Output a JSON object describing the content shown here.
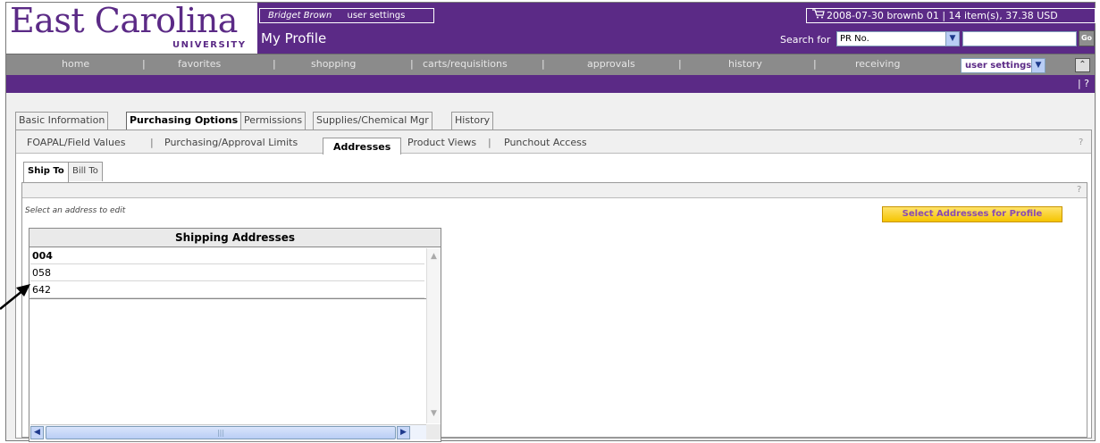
{
  "header": {
    "logo_main": "East Carolina",
    "logo_sub": "UNIVERSITY",
    "user_name": "Bridget Brown",
    "user_settings_link": "user settings",
    "page_title": "My Profile",
    "cart_summary": "2008-07-30 brownb 01 | 14 item(s), 37.38 USD",
    "search_label": "Search for",
    "search_type": "PR No.",
    "search_value": "",
    "go_label": "Go"
  },
  "nav": {
    "items": [
      "home",
      "favorites",
      "shopping",
      "carts/requisitions",
      "approvals",
      "history",
      "receiving"
    ],
    "settings_select": "user settings"
  },
  "tabs": {
    "items": [
      "Basic Information",
      "Purchasing Options",
      "Permissions",
      "Supplies/Chemical Mgr",
      "History"
    ],
    "active": "Purchasing Options"
  },
  "subnav": {
    "items": [
      "FOAPAL/Field Values",
      "Purchasing/Approval Limits",
      "Addresses",
      "Product Views",
      "Punchout Access"
    ],
    "active": "Addresses"
  },
  "address_tabs": {
    "items": [
      "Ship To",
      "Bill To"
    ],
    "active": "Ship To"
  },
  "panel": {
    "hint": "Select an address to edit",
    "select_button": "Select Addresses for Profile",
    "help": "?"
  },
  "grid": {
    "title": "Shipping Addresses",
    "rows": [
      "004",
      "058",
      "642"
    ]
  },
  "colors": {
    "brand_purple": "#5b2a86",
    "nav_gray": "#8b8b8b",
    "button_yellow": "#f5c400"
  }
}
